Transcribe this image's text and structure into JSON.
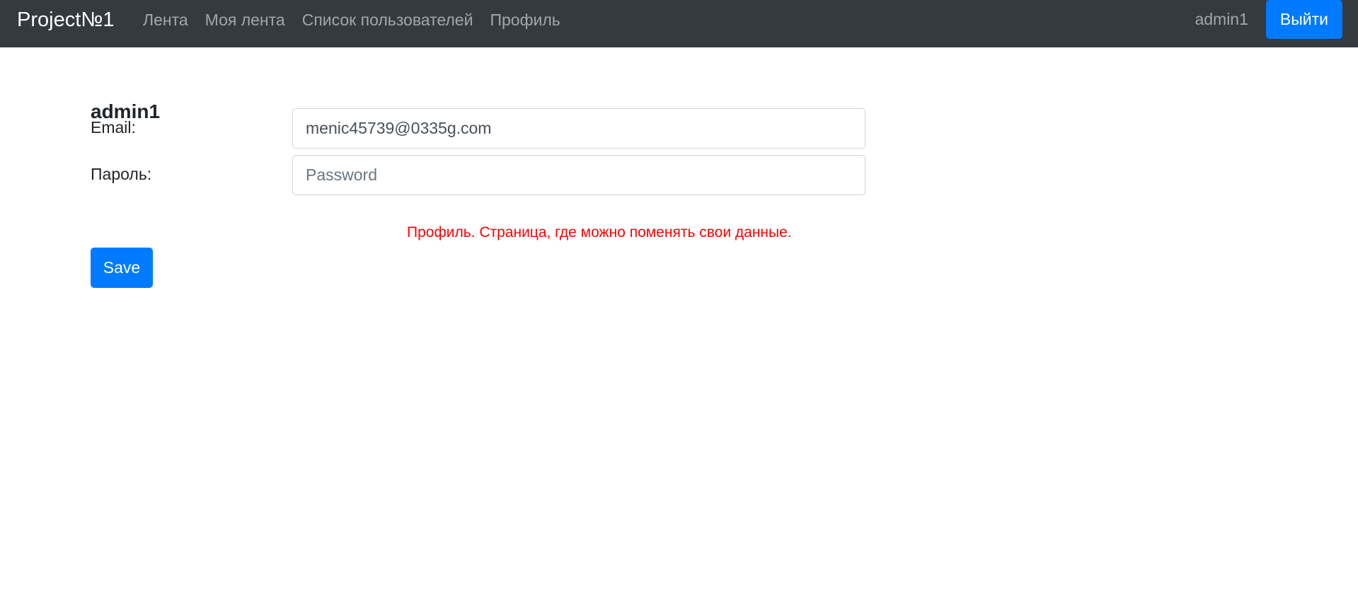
{
  "navbar": {
    "brand": "Project№1",
    "links": [
      {
        "label": "Лента"
      },
      {
        "label": "Моя лента"
      },
      {
        "label": "Список пользователей"
      },
      {
        "label": "Профиль"
      }
    ],
    "username": "admin1",
    "logout_label": "Выйти"
  },
  "profile": {
    "heading": "admin1",
    "email_label": "Email:",
    "email_value": "menic45739@0335g.com",
    "password_label": "Пароль:",
    "password_placeholder": "Password",
    "save_label": "Save"
  },
  "annotation": "Профиль. Страница, где можно поменять свои данные.",
  "colors": {
    "navbar_bg": "#343a40",
    "primary": "#007bff",
    "annotation": "#ff0000"
  }
}
